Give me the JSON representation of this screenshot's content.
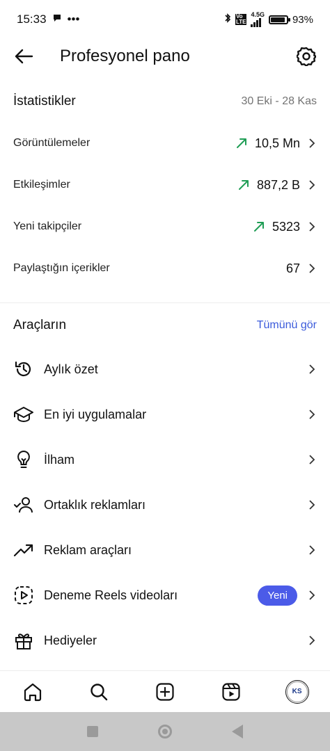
{
  "status_bar": {
    "time": "15:33",
    "extra": "•••",
    "network": "4.5G",
    "battery": "93%",
    "battery_level": 0.93
  },
  "header": {
    "title": "Profesyonel pano"
  },
  "stats": {
    "heading": "İstatistikler",
    "date_range": "30 Eki - 28 Kas",
    "rows": [
      {
        "label": "Görüntülemeler",
        "value": "10,5 Mn",
        "trend": "up"
      },
      {
        "label": "Etkileşimler",
        "value": "887,2 B",
        "trend": "up"
      },
      {
        "label": "Yeni takipçiler",
        "value": "5323",
        "trend": "up"
      },
      {
        "label": "Paylaştığın içerikler",
        "value": "67",
        "trend": "none"
      }
    ]
  },
  "tools": {
    "heading": "Araçların",
    "see_all": "Tümünü gör",
    "items": [
      {
        "label": "Aylık özet",
        "icon": "history-icon"
      },
      {
        "label": "En iyi uygulamalar",
        "icon": "graduation-cap-icon"
      },
      {
        "label": "İlham",
        "icon": "lightbulb-icon"
      },
      {
        "label": "Ortaklık reklamları",
        "icon": "person-check-icon"
      },
      {
        "label": "Reklam araçları",
        "icon": "trending-up-icon"
      },
      {
        "label": "Deneme Reels videoları",
        "icon": "reels-trial-icon",
        "badge": "Yeni"
      },
      {
        "label": "Hediyeler",
        "icon": "gift-icon"
      }
    ]
  },
  "bottom_nav": {
    "items": [
      "home-icon",
      "search-icon",
      "create-icon",
      "reels-icon",
      "profile-avatar"
    ],
    "avatar_initials": "KS"
  },
  "colors": {
    "trend_green": "#1f9d55",
    "link_blue": "#3b5bdb",
    "badge_blue": "#4b5be8"
  }
}
